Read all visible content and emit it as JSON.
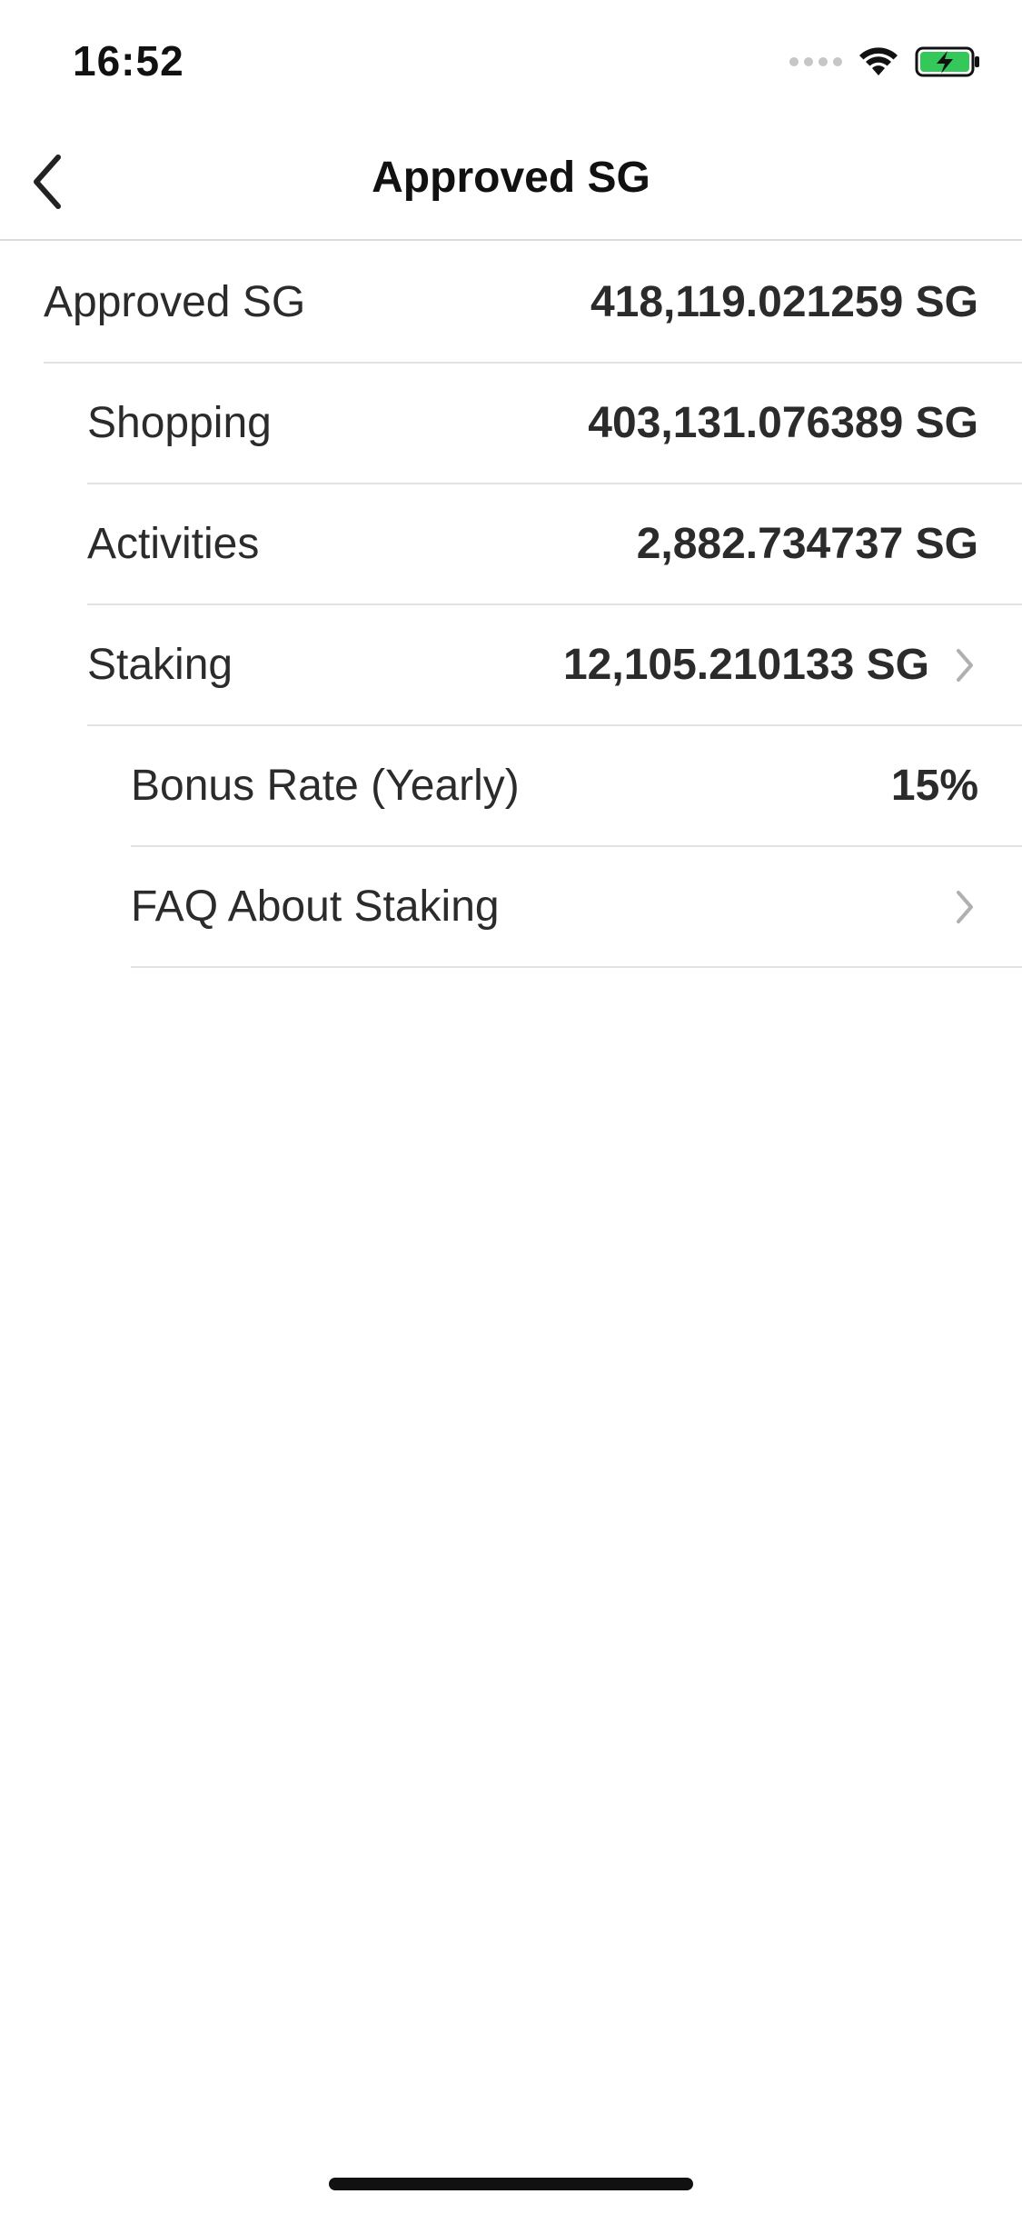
{
  "status_bar": {
    "time": "16:52",
    "icons": [
      "signal-dots-icon",
      "wifi-icon",
      "battery-charging-icon"
    ],
    "battery_color": "#34c759"
  },
  "nav": {
    "back_icon": "chevron-left-icon",
    "title": "Approved SG"
  },
  "list": {
    "approved": {
      "label": "Approved SG",
      "value": "418,119.021259 SG"
    },
    "shopping": {
      "label": "Shopping",
      "value": "403,131.076389 SG"
    },
    "activities": {
      "label": "Activities",
      "value": "2,882.734737 SG"
    },
    "staking": {
      "label": "Staking",
      "value": "12,105.210133 SG",
      "icon": "chevron-right-icon"
    },
    "bonus_rate": {
      "label": "Bonus Rate (Yearly)",
      "value": "15%"
    },
    "faq": {
      "label": "FAQ About Staking",
      "icon": "chevron-right-icon"
    }
  },
  "colors": {
    "text": "#2b2b2b",
    "separator": "#e2e2e2",
    "chevron": "#b0b0b0"
  }
}
